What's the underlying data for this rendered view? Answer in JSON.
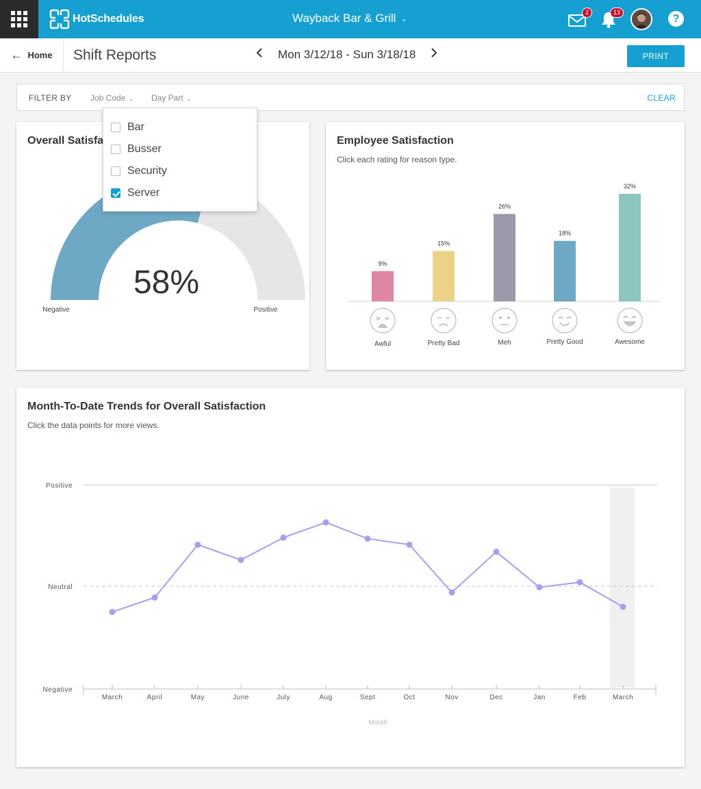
{
  "topbar": {
    "brand": "HotSchedules",
    "venue": "Wayback Bar & Grill",
    "mail_count": "2",
    "notification_count": "13",
    "help_label": "?"
  },
  "subheader": {
    "home_label": "Home",
    "page_title": "Shift Reports",
    "date_range": "Mon 3/12/18 - Sun 3/18/18",
    "print_label": "PRINT"
  },
  "filters": {
    "label": "FILTER BY",
    "job_code": "Job Code",
    "day_part": "Day Part",
    "clear_label": "CLEAR",
    "job_code_options": [
      {
        "label": "Bar",
        "checked": false
      },
      {
        "label": "Busser",
        "checked": false
      },
      {
        "label": "Security",
        "checked": false
      },
      {
        "label": "Server",
        "checked": true
      }
    ]
  },
  "overall": {
    "title": "Overall Satisfaction",
    "value_label": "58%",
    "value": 58,
    "left_label": "Negative",
    "right_label": "Positive"
  },
  "employee": {
    "title": "Employee Satisfaction",
    "subtitle": "Click each rating for reason type."
  },
  "trends": {
    "title": "Month-To-Date Trends for Overall Satisfaction",
    "subtitle": "Click the data points for more views."
  },
  "colors": {
    "brand": "#16a0d2",
    "gauge_fill": "#6fa8c4",
    "gauge_bg": "#e6e6e6",
    "trend_line": "#a99ded",
    "badge": "#c4102f"
  },
  "chart_data": [
    {
      "type": "bar",
      "title": "Employee Satisfaction",
      "categories": [
        "Awful",
        "Pretty Bad",
        "Meh",
        "Pretty Good",
        "Awesome"
      ],
      "values": [
        9,
        15,
        26,
        18,
        32
      ],
      "value_labels": [
        "9%",
        "15%",
        "26%",
        "18%",
        "32%"
      ],
      "colors": [
        "#df86a4",
        "#ecd288",
        "#9b99aa",
        "#6fa8c4",
        "#8ec5bf"
      ],
      "icons": [
        "awful-face-icon",
        "pretty-bad-face-icon",
        "meh-face-icon",
        "pretty-good-face-icon",
        "awesome-face-icon"
      ],
      "ylim": [
        0,
        32
      ]
    },
    {
      "type": "line",
      "title": "Month-To-Date Trends for Overall Satisfaction",
      "xlabel": "Month",
      "categories": [
        "March",
        "April",
        "May",
        "June",
        "July",
        "Aug",
        "Sept",
        "Oct",
        "Nov",
        "Dec",
        "Jan",
        "Feb",
        "March"
      ],
      "values": [
        -0.25,
        -0.11,
        0.41,
        0.26,
        0.48,
        0.63,
        0.47,
        0.41,
        -0.06,
        0.34,
        -0.01,
        0.04,
        -0.2
      ],
      "y_tick_labels": [
        "Positive",
        "Neutral",
        "Negative"
      ],
      "ylim": [
        -1,
        1
      ],
      "highlight_index": 12
    }
  ]
}
